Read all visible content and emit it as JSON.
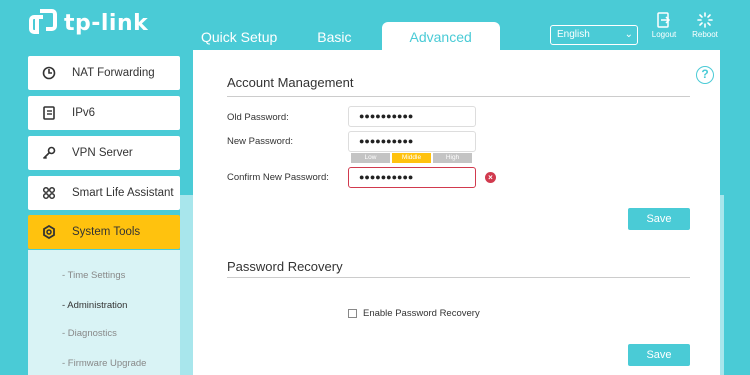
{
  "brand": {
    "logo_text": "tp-link",
    "accent": "#4acbd6",
    "highlight": "#ffc20e",
    "error": "#d13a4e"
  },
  "tabs": [
    {
      "label": "Quick Setup"
    },
    {
      "label": "Basic"
    },
    {
      "label": "Advanced",
      "active": true
    }
  ],
  "language": {
    "selected": "English"
  },
  "header_buttons": {
    "logout": "Logout",
    "reboot": "Reboot"
  },
  "sidebar": {
    "items": [
      {
        "label": "NAT Forwarding",
        "icon": "nat-forwarding-icon"
      },
      {
        "label": "IPv6",
        "icon": "ipv6-icon"
      },
      {
        "label": "VPN Server",
        "icon": "vpn-key-icon"
      },
      {
        "label": "Smart Life Assistant",
        "icon": "smart-life-icon"
      },
      {
        "label": "System Tools",
        "icon": "system-tools-icon",
        "active": true
      }
    ],
    "sub_items": [
      {
        "label": "- Time Settings"
      },
      {
        "label": "- Administration",
        "active": true
      },
      {
        "label": "- Diagnostics"
      },
      {
        "label": "- Firmware Upgrade"
      }
    ]
  },
  "account": {
    "title": "Account Management",
    "old_label": "Old Password:",
    "old_value": "●●●●●●●●●●",
    "new_label": "New Password:",
    "new_value": "●●●●●●●●●●",
    "confirm_label": "Confirm New Password:",
    "confirm_value": "●●●●●●●●●●",
    "strength": [
      "Low",
      "Middle",
      "High"
    ],
    "strength_level": "Middle",
    "save_label": "Save"
  },
  "recovery": {
    "title": "Password Recovery",
    "checkbox_label": "Enable Password Recovery",
    "checked": false,
    "save_label": "Save"
  },
  "help_symbol": "?",
  "error_symbol": "×"
}
